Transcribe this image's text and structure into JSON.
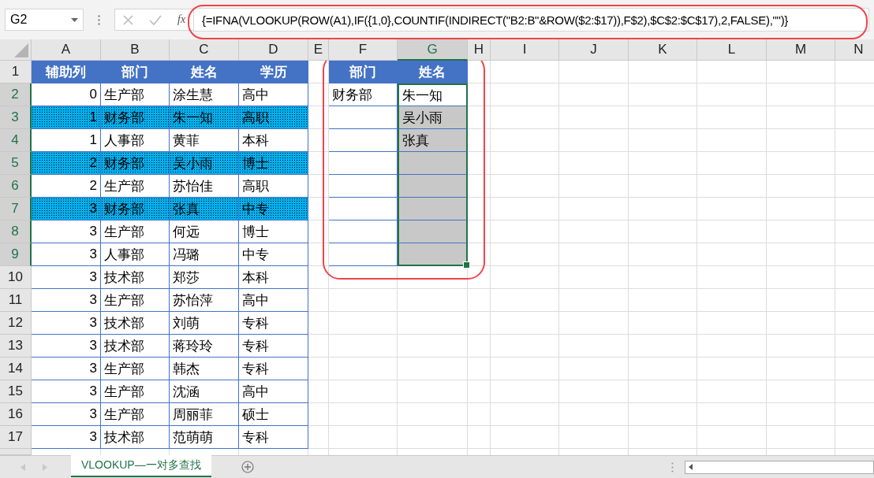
{
  "formula_bar": {
    "name_box": "G2",
    "function_label": "fx",
    "formula": "{=IFNA(VLOOKUP(ROW(A1),IF({1,0},COUNTIF(INDIRECT(\"B2:B\"&ROW($2:$17)),F$2),$C$2:$C$17),2,FALSE),\"\")}"
  },
  "columns": [
    {
      "label": "A",
      "selected": false
    },
    {
      "label": "B",
      "selected": false
    },
    {
      "label": "C",
      "selected": false
    },
    {
      "label": "D",
      "selected": false
    },
    {
      "label": "E",
      "selected": false
    },
    {
      "label": "F",
      "selected": false
    },
    {
      "label": "G",
      "selected": true
    },
    {
      "label": "H",
      "selected": false
    },
    {
      "label": "I",
      "selected": false
    },
    {
      "label": "J",
      "selected": false
    },
    {
      "label": "K",
      "selected": false
    },
    {
      "label": "L",
      "selected": false
    },
    {
      "label": "M",
      "selected": false
    },
    {
      "label": "N",
      "selected": false
    }
  ],
  "rows": [
    {
      "label": "1",
      "selected": false
    },
    {
      "label": "2",
      "selected": true
    },
    {
      "label": "3",
      "selected": true
    },
    {
      "label": "4",
      "selected": true
    },
    {
      "label": "5",
      "selected": true
    },
    {
      "label": "6",
      "selected": true
    },
    {
      "label": "7",
      "selected": true
    },
    {
      "label": "8",
      "selected": true
    },
    {
      "label": "9",
      "selected": true
    },
    {
      "label": "10",
      "selected": false
    },
    {
      "label": "11",
      "selected": false
    },
    {
      "label": "12",
      "selected": false
    },
    {
      "label": "13",
      "selected": false
    },
    {
      "label": "14",
      "selected": false
    },
    {
      "label": "15",
      "selected": false
    },
    {
      "label": "16",
      "selected": false
    },
    {
      "label": "17",
      "selected": false
    }
  ],
  "source_table": {
    "header": [
      "辅助列",
      "部门",
      "姓名",
      "学历"
    ],
    "rows": [
      {
        "helper": "0",
        "dept": "生产部",
        "name": "涂生慧",
        "education": "高中",
        "highlighted": false
      },
      {
        "helper": "1",
        "dept": "财务部",
        "name": "朱一知",
        "education": "高职",
        "highlighted": true
      },
      {
        "helper": "1",
        "dept": "人事部",
        "name": "黄菲",
        "education": "本科",
        "highlighted": false
      },
      {
        "helper": "2",
        "dept": "财务部",
        "name": "吴小雨",
        "education": "博士",
        "highlighted": true
      },
      {
        "helper": "2",
        "dept": "生产部",
        "name": "苏怡佳",
        "education": "高职",
        "highlighted": false
      },
      {
        "helper": "3",
        "dept": "财务部",
        "name": "张真",
        "education": "中专",
        "highlighted": true
      },
      {
        "helper": "3",
        "dept": "生产部",
        "name": "何远",
        "education": "博士",
        "highlighted": false
      },
      {
        "helper": "3",
        "dept": "人事部",
        "name": "冯璐",
        "education": "中专",
        "highlighted": false
      },
      {
        "helper": "3",
        "dept": "技术部",
        "name": "郑莎",
        "education": "本科",
        "highlighted": false
      },
      {
        "helper": "3",
        "dept": "生产部",
        "name": "苏怡萍",
        "education": "高中",
        "highlighted": false
      },
      {
        "helper": "3",
        "dept": "技术部",
        "name": "刘萌",
        "education": "专科",
        "highlighted": false
      },
      {
        "helper": "3",
        "dept": "技术部",
        "name": "蒋玲玲",
        "education": "专科",
        "highlighted": false
      },
      {
        "helper": "3",
        "dept": "生产部",
        "name": "韩杰",
        "education": "专科",
        "highlighted": false
      },
      {
        "helper": "3",
        "dept": "生产部",
        "name": "沈涵",
        "education": "高中",
        "highlighted": false
      },
      {
        "helper": "3",
        "dept": "生产部",
        "name": "周丽菲",
        "education": "硕士",
        "highlighted": false
      },
      {
        "helper": "3",
        "dept": "技术部",
        "name": "范萌萌",
        "education": "专科",
        "highlighted": false
      }
    ]
  },
  "result_table": {
    "header": [
      "部门",
      "姓名"
    ],
    "rows": [
      {
        "dept": "财务部",
        "name": "朱一知",
        "active": true
      },
      {
        "name": "吴小雨",
        "active": false
      },
      {
        "name": "张真",
        "active": false
      },
      {
        "active": false
      },
      {
        "active": false
      },
      {
        "active": false
      },
      {
        "active": false
      },
      {
        "active": false
      }
    ]
  },
  "sheet_tabs": [
    {
      "label": "VLOOKUP—一对多查找",
      "selected": true
    }
  ]
}
